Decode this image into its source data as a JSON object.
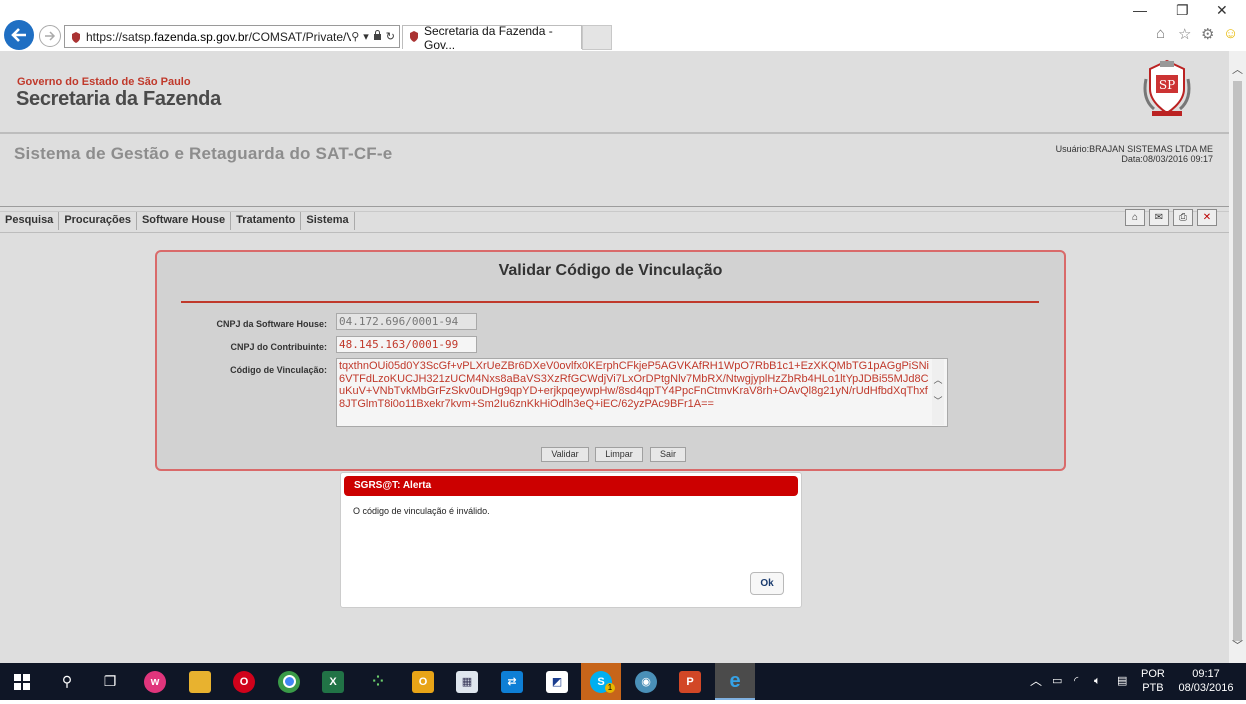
{
  "browser": {
    "url_prefix": "https://satsp.",
    "url_domain": "fazenda.sp.gov.br",
    "url_rest": "/COMSAT/Private/V",
    "tab_title": "Secretaria da Fazenda - Gov..."
  },
  "header": {
    "gov_label": "Governo do Estado de São Paulo",
    "brand": "Secretaria da Fazenda",
    "system_title": "Sistema de Gestão e Retaguarda do SAT-CF-e",
    "user_line": "Usuário:BRAJAN SISTEMAS LTDA ME",
    "date_line": "Data:08/03/2016 09:17"
  },
  "menu": {
    "items": [
      "Pesquisa",
      "Procurações",
      "Software House",
      "Tratamento",
      "Sistema"
    ]
  },
  "form": {
    "title": "Validar Código de Vinculação",
    "cnpj_sh_label": "CNPJ da Software House:",
    "cnpj_sh_value": "04.172.696/0001-94",
    "cnpj_contrib_label": "CNPJ do Contribuinte:",
    "cnpj_contrib_value": "48.145.163/0001-99",
    "codigo_label": "Código de Vinculação:",
    "codigo_value": "tqxthnOUi05d0Y3ScGf+vPLXrUeZBr6DXeV0ovlfx0KErphCFkjeP5AGVKAfRH1WpO7RbB1c1+EzXKQMbTG1pAGgPiSNi6VTFdLzoKUCJH321zUCM4Nxs8aBaVS3XzRfGCWdjVi7LxOrDPtgNlv7MbRX/NtwgjyplHzZbRb4HLo1ltYpJDBi55MJd8CuKuV+VNbTvkMbGrFzSkv0uDHg9qpYD+erjkpqeywpHw/8sd4qpTY4PpcFnCtmvKraV8rh+OAvQl8g21yN/rUdHfbdXqThxf8JTGlmT8i0o11Bxekr7kvm+Sm2Iu6znKkHiOdlh3eQ+iEC/62yzPAc9BFr1A==",
    "btn_validar": "Validar",
    "btn_limpar": "Limpar",
    "btn_sair": "Sair"
  },
  "alert": {
    "title": "SGRS@T: Alerta",
    "message": "O código de vinculação é inválido.",
    "ok": "Ok"
  },
  "taskbar": {
    "lang_top": "POR",
    "lang_bottom": "PTB",
    "time": "09:17",
    "date": "08/03/2016",
    "skype_badge": "1"
  }
}
